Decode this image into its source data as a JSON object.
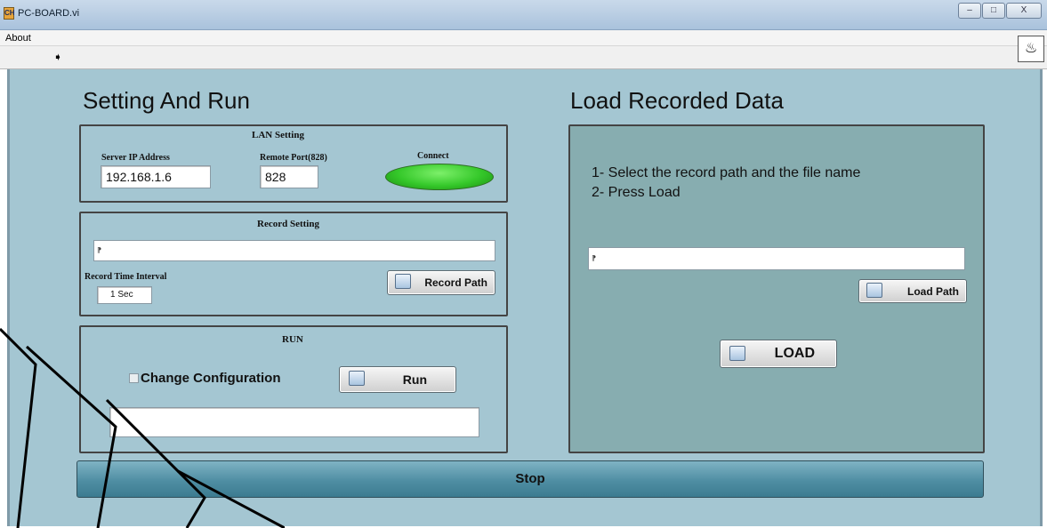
{
  "window": {
    "title": "PC-BOARD.vi",
    "app_icon": "ch-icon",
    "minimize": "–",
    "maximize": "□",
    "close": "X"
  },
  "menu": {
    "items": [
      "About"
    ]
  },
  "toolbar": {
    "run_arrow_icon": "run-arrow-icon",
    "vi_icon": "vi-icon"
  },
  "left": {
    "title": "Setting And Run",
    "lan": {
      "label": "LAN Setting",
      "ip_label": "Server IP Address",
      "ip_value": "192.168.1.6",
      "port_label": "Remote Port(828)",
      "port_value": "828",
      "connect_label": "Connect",
      "connect_color": "#35c82a"
    },
    "record": {
      "label": "Record Setting",
      "path_value": "",
      "interval_label": "Record Time Interval",
      "interval_value": "1 Sec",
      "button_label": "Record Path"
    },
    "run": {
      "label": "RUN",
      "change_config_label": "Change Configuration",
      "change_config_checked": false,
      "run_button_label": "Run",
      "status_value": ""
    }
  },
  "right": {
    "title": "Load Recorded Data",
    "instructions": [
      "1- Select the record path and the file name",
      "2- Press Load"
    ],
    "path_value": "",
    "load_path_label": "Load Path",
    "load_label": "LOAD"
  },
  "stop_label": "Stop",
  "colors": {
    "panel_bg": "#a4c6d2",
    "load_bg": "#87adb0",
    "stop_bg": "#4f8ea3"
  }
}
